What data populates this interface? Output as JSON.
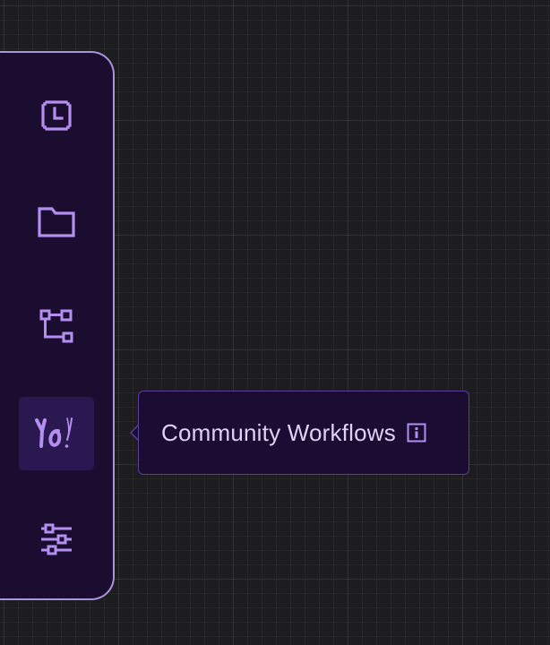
{
  "sidebar": {
    "items": [
      {
        "id": "history",
        "icon": "clock-icon",
        "active": false
      },
      {
        "id": "files",
        "icon": "folder-icon",
        "active": false
      },
      {
        "id": "workflows",
        "icon": "workflow-icon",
        "active": false
      },
      {
        "id": "community",
        "icon": "yo-logo-icon",
        "logo_text": "Yo!",
        "active": true
      },
      {
        "id": "settings",
        "icon": "sliders-icon",
        "active": false
      }
    ]
  },
  "tooltip": {
    "label": "Community Workflows",
    "icon": "info-icon"
  },
  "colors": {
    "background": "#1d1d1f",
    "sidebar_bg": "#1a0d30",
    "sidebar_border": "#a993dd",
    "icon": "#b48ff0",
    "active_item_bg": "#2a1850",
    "tooltip_bg": "#1b0d31",
    "tooltip_border": "#5b3e9a",
    "tooltip_text": "#ddd2f2"
  }
}
